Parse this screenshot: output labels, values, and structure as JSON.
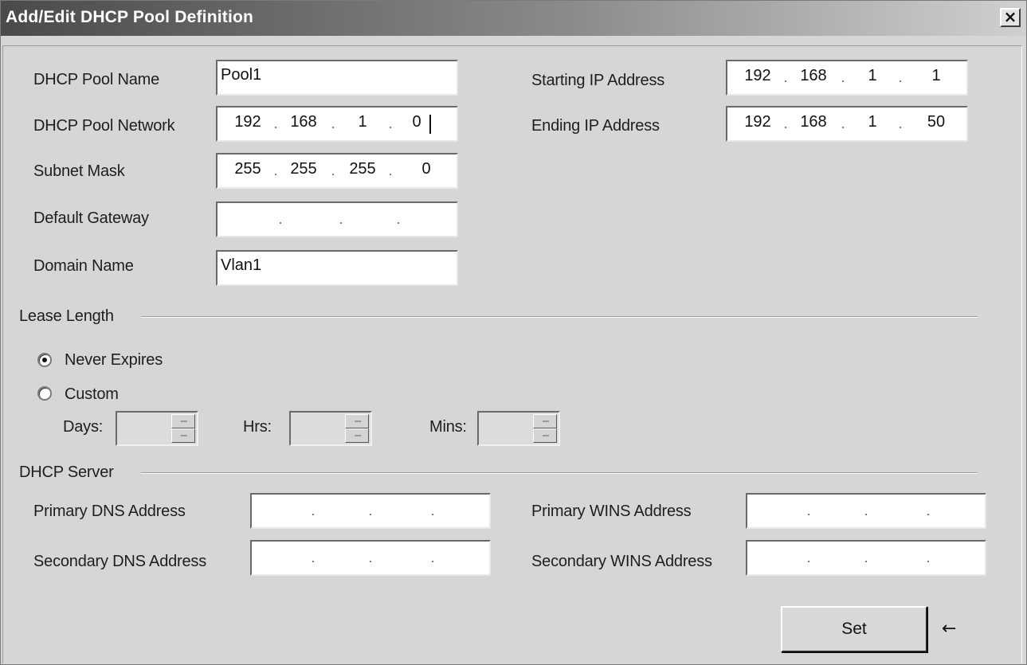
{
  "window": {
    "title": "Add/Edit DHCP Pool Definition",
    "close_glyph": "×"
  },
  "pool": {
    "name_label": "DHCP Pool Name",
    "name_value": "Pool1",
    "network_label": "DHCP Pool Network",
    "network": [
      "192",
      "168",
      "1",
      "0"
    ],
    "subnet_label": "Subnet Mask",
    "subnet": [
      "255",
      "255",
      "255",
      "0"
    ],
    "gateway_label": "Default Gateway",
    "gateway": [
      "",
      "",
      "",
      ""
    ],
    "domain_label": "Domain Name",
    "domain_value": "Vlan1",
    "start_label": "Starting IP Address",
    "start": [
      "192",
      "168",
      "1",
      "1"
    ],
    "end_label": "Ending IP Address",
    "end": [
      "192",
      "168",
      "1",
      "50"
    ]
  },
  "lease": {
    "group_label": "Lease Length",
    "never_label": "Never Expires",
    "custom_label": "Custom",
    "selected": "never",
    "days_label": "Days:",
    "hrs_label": "Hrs:",
    "mins_label": "Mins:",
    "days_value": "",
    "hrs_value": "",
    "mins_value": ""
  },
  "server": {
    "group_label": "DHCP Server",
    "primary_dns_label": "Primary DNS Address",
    "primary_dns": [
      "",
      "",
      "",
      ""
    ],
    "secondary_dns_label": "Secondary DNS Address",
    "secondary_dns": [
      "",
      "",
      "",
      ""
    ],
    "primary_wins_label": "Primary WINS Address",
    "primary_wins": [
      "",
      "",
      "",
      ""
    ],
    "secondary_wins_label": "Secondary WINS Address",
    "secondary_wins": [
      "",
      "",
      "",
      ""
    ]
  },
  "actions": {
    "set_label": "Set",
    "arrow_glyph": "←"
  },
  "icons": {
    "close": "close-icon",
    "spin_up": "spin-up-icon",
    "spin_down": "spin-down-icon",
    "arrow": "arrow-left-icon"
  },
  "colors": {
    "title_start": "#4a4a4a",
    "title_end": "#d0d0d0",
    "window_bg": "#d6d6d6",
    "field_bg": "#ffffff"
  }
}
